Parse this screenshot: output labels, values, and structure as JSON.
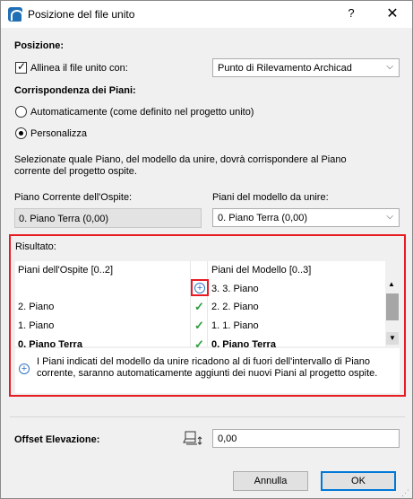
{
  "window": {
    "title": "Posizione del file unito",
    "help_label": "?",
    "close_label": "✕"
  },
  "posizione": {
    "heading": "Posizione:",
    "align_checkbox_label": "Allinea il file unito con:",
    "align_checked": true,
    "align_dropdown_value": "Punto di Rilevamento Archicad"
  },
  "corrispondenza": {
    "heading": "Corrispondenza dei Piani:",
    "radio_auto_label": "Automaticamente (come definito nel progetto unito)",
    "radio_custom_label": "Personalizza",
    "selected": "custom",
    "description_line1": "Selezionate quale Piano, del modello da unire, dovrà corrispondere al Piano",
    "description_line2": "corrente del progetto ospite."
  },
  "host_story": {
    "label": "Piano Corrente dell'Ospite:",
    "value": "0. Piano Terra (0,00)"
  },
  "model_story": {
    "label": "Piani del modello da unire:",
    "value": "0. Piano Terra (0,00)"
  },
  "risultato": {
    "heading": "Risultato:",
    "col_host": "Piani dell'Ospite [0..2]",
    "col_model": "Piani del Modello [0..3]",
    "rows": [
      {
        "host": "",
        "status": "plus",
        "model": "3. 3. Piano"
      },
      {
        "host": "2. Piano",
        "status": "check",
        "model": "2. 2. Piano"
      },
      {
        "host": "1. Piano",
        "status": "check",
        "model": "1. 1. Piano"
      },
      {
        "host": "0. Piano Terra",
        "status": "check",
        "model": "0. Piano Terra"
      }
    ],
    "info_text": "I Piani indicati del modello da unire ricadono al di fuori dell'intervallo di Piano corrente, saranno automaticamente aggiunti dei nuovi Piani al progetto ospite."
  },
  "offset": {
    "label": "Offset Elevazione:",
    "value": "0,00"
  },
  "buttons": {
    "cancel": "Annulla",
    "ok": "OK"
  },
  "icons": {
    "app": "archicad-icon",
    "plus": "plus-circle-icon",
    "check": "checkmark-icon",
    "elevation": "elevation-offset-icon"
  },
  "colors": {
    "highlight_border": "#e81b23",
    "check_green": "#2a9d3b",
    "info_blue": "#2f74c0",
    "ok_border": "#0078d7"
  }
}
